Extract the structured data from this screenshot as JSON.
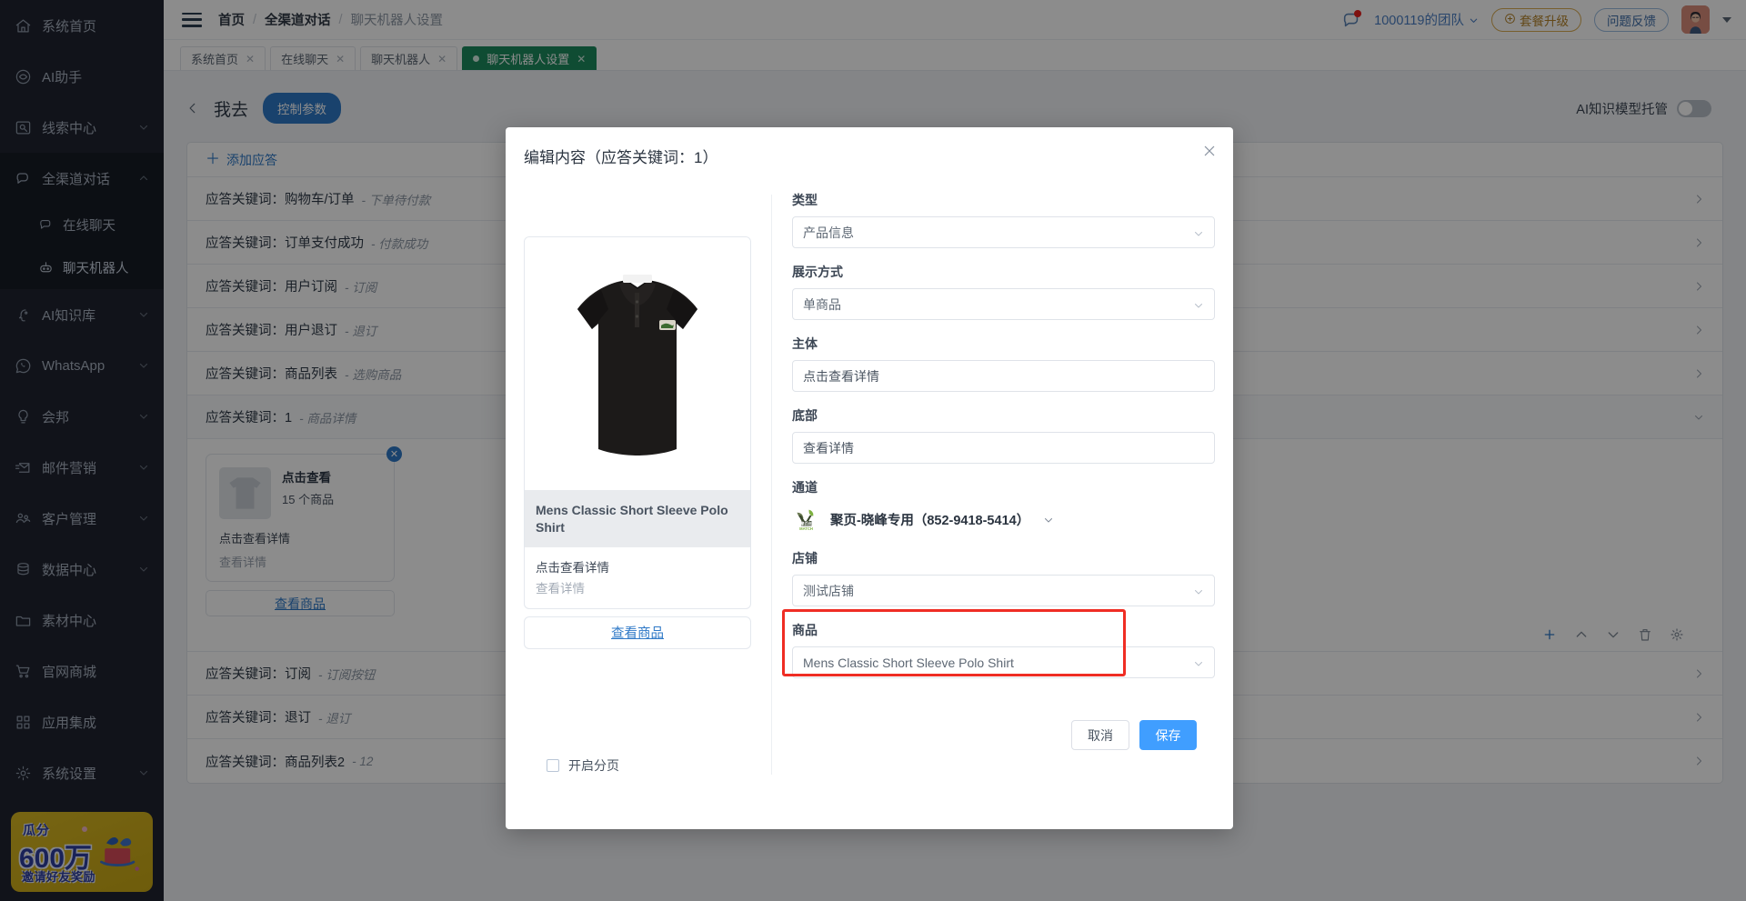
{
  "sidebar": {
    "items": [
      {
        "label": "系统首页",
        "icon": "home-icon",
        "chevron": false
      },
      {
        "label": "AI助手",
        "icon": "ai-assistant-icon",
        "chevron": false
      },
      {
        "label": "线索中心",
        "icon": "lead-center-icon",
        "chevron": true
      },
      {
        "label": "全渠道对话",
        "icon": "omnichannel-chat-icon",
        "chevron": true,
        "expanded": true,
        "children": [
          {
            "label": "在线聊天",
            "icon": "live-chat-icon"
          },
          {
            "label": "聊天机器人",
            "icon": "chatbot-icon",
            "active": true
          }
        ]
      },
      {
        "label": "AI知识库",
        "icon": "ai-knowledge-icon",
        "chevron": true
      },
      {
        "label": "WhatsApp",
        "icon": "whatsapp-icon",
        "chevron": true
      },
      {
        "label": "会邦",
        "icon": "huibang-icon",
        "chevron": true
      },
      {
        "label": "邮件营销",
        "icon": "email-marketing-icon",
        "chevron": true
      },
      {
        "label": "客户管理",
        "icon": "customer-management-icon",
        "chevron": true
      },
      {
        "label": "数据中心",
        "icon": "data-center-icon",
        "chevron": true
      },
      {
        "label": "素材中心",
        "icon": "material-center-icon",
        "chevron": false
      },
      {
        "label": "官网商城",
        "icon": "shop-icon",
        "chevron": false
      },
      {
        "label": "应用集成",
        "icon": "app-integration-icon",
        "chevron": false
      },
      {
        "label": "系统设置",
        "icon": "settings-icon",
        "chevron": true
      }
    ],
    "promo": {
      "line1": "瓜分",
      "line2": "600万",
      "line3": "邀请好友奖励"
    }
  },
  "header": {
    "breadcrumb": [
      "首页",
      "全渠道对话",
      "聊天机器人设置"
    ],
    "team": "1000119的团队",
    "upgrade_label": "套餐升级",
    "feedback_label": "问题反馈"
  },
  "tabs": [
    {
      "label": "系统首页",
      "active": false
    },
    {
      "label": "在线聊天",
      "active": false
    },
    {
      "label": "聊天机器人",
      "active": false
    },
    {
      "label": "聊天机器人设置",
      "active": true
    }
  ],
  "page": {
    "title": "我去",
    "control_button": "控制参数",
    "ai_toggle_label": "AI知识模型托管",
    "ai_toggle_on": false,
    "add_label": "添加应答",
    "keyword_prefix": "应答关键词：",
    "rows": [
      {
        "keyword": "应答关键词：购物车/订单",
        "sub": "- 下单待付款"
      },
      {
        "keyword": "应答关键词：订单支付成功",
        "sub": "- 付款成功"
      },
      {
        "keyword": "应答关键词：用户订阅",
        "sub": "- 订阅"
      },
      {
        "keyword": "应答关键词：用户退订",
        "sub": "- 退订"
      },
      {
        "keyword": "应答关键词：商品列表",
        "sub": "- 选购商品"
      }
    ],
    "expanded_row": {
      "keyword": "应答关键词：1",
      "sub": "- 商品详情"
    },
    "bubble": {
      "title": "点击查看",
      "count": "15 个商品",
      "body": "点击查看详情",
      "footer": "查看详情",
      "button": "查看商品"
    },
    "rows_after": [
      {
        "keyword": "应答关键词：订阅",
        "sub": "- 订阅按钮"
      },
      {
        "keyword": "应答关键词：退订",
        "sub": "- 退订"
      },
      {
        "keyword": "应答关键词：商品列表2",
        "sub": "- 12"
      }
    ],
    "tool_icons": [
      "add-icon",
      "move-up-icon",
      "move-down-icon",
      "delete-icon",
      "settings-icon"
    ]
  },
  "modal": {
    "title": "编辑内容（应答关键词：1）",
    "preview": {
      "product_name": "Mens Classic Short Sleeve Polo Shirt",
      "body": "点击查看详情",
      "footer": "查看详情",
      "button": "查看商品"
    },
    "pagination": {
      "label": "开启分页",
      "checked": false
    },
    "fields": {
      "type": {
        "label": "类型",
        "value": "产品信息"
      },
      "display": {
        "label": "展示方式",
        "value": "单商品"
      },
      "main": {
        "label": "主体",
        "value": "点击查看详情"
      },
      "bottom": {
        "label": "底部",
        "value": "查看详情"
      },
      "channel": {
        "label": "通道",
        "value": "聚页-晓峰专用（852-9418-5414）",
        "logo_text": "MATCH"
      },
      "store": {
        "label": "店铺",
        "value": "测试店铺"
      },
      "product": {
        "label": "商品",
        "value": "Mens Classic Short Sleeve Polo Shirt",
        "highlighted": true
      }
    },
    "footer": {
      "cancel": "取消",
      "save": "保存"
    },
    "highlight_color": "#ef2d24",
    "accent_color": "#409eff"
  }
}
